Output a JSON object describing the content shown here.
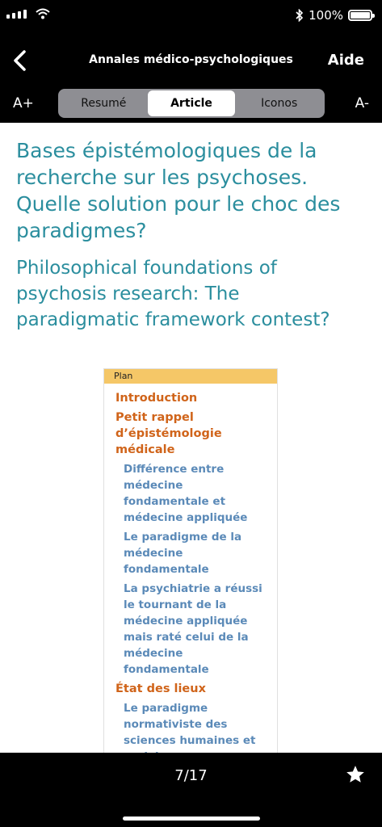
{
  "status_bar": {
    "battery_text": "100%"
  },
  "nav": {
    "title": "Annales médico-psychologiques",
    "help_label": "Aide"
  },
  "toolbar": {
    "increase_font": "A+",
    "decrease_font": "A-",
    "segments": [
      {
        "label": "Resumé",
        "active": false
      },
      {
        "label": "Article",
        "active": true
      },
      {
        "label": "Iconos",
        "active": false
      }
    ]
  },
  "article": {
    "title_fr": "Bases épistémologiques de la recherche sur les psychoses. Quelle solution pour le choc des paradigmes?",
    "title_en": "Philosophical foundations of psychosis research: The paradigmatic framework contest?",
    "plan": {
      "header": "Plan",
      "items": [
        {
          "level": 1,
          "text": "Introduction"
        },
        {
          "level": 1,
          "text": "Petit rappel d’épistémologie médicale"
        },
        {
          "level": 2,
          "text": "Différence entre médecine fondamentale et médecine appliquée"
        },
        {
          "level": 2,
          "text": "Le paradigme de la médecine fondamentale"
        },
        {
          "level": 2,
          "text": "La psychiatrie a réussi le tournant de la médecine appliquée mais raté celui de la médecine fondamentale"
        },
        {
          "level": 1,
          "text": "État des lieux"
        },
        {
          "level": 2,
          "text": "Le paradigme normativiste des sciences humaines et sociales"
        }
      ]
    }
  },
  "footer": {
    "page_indicator": "7/17"
  },
  "icons": {
    "back": "chevron-left-icon",
    "favorite": "star-icon",
    "wifi": "wifi-icon",
    "bluetooth": "bluetooth-icon",
    "battery": "battery-icon",
    "signal": "signal-icon"
  },
  "colors": {
    "title": "#2b8e9e",
    "plan_level1": "#d0641a",
    "plan_level2": "#5b8ab8",
    "plan_header_bg": "#f5c767"
  }
}
